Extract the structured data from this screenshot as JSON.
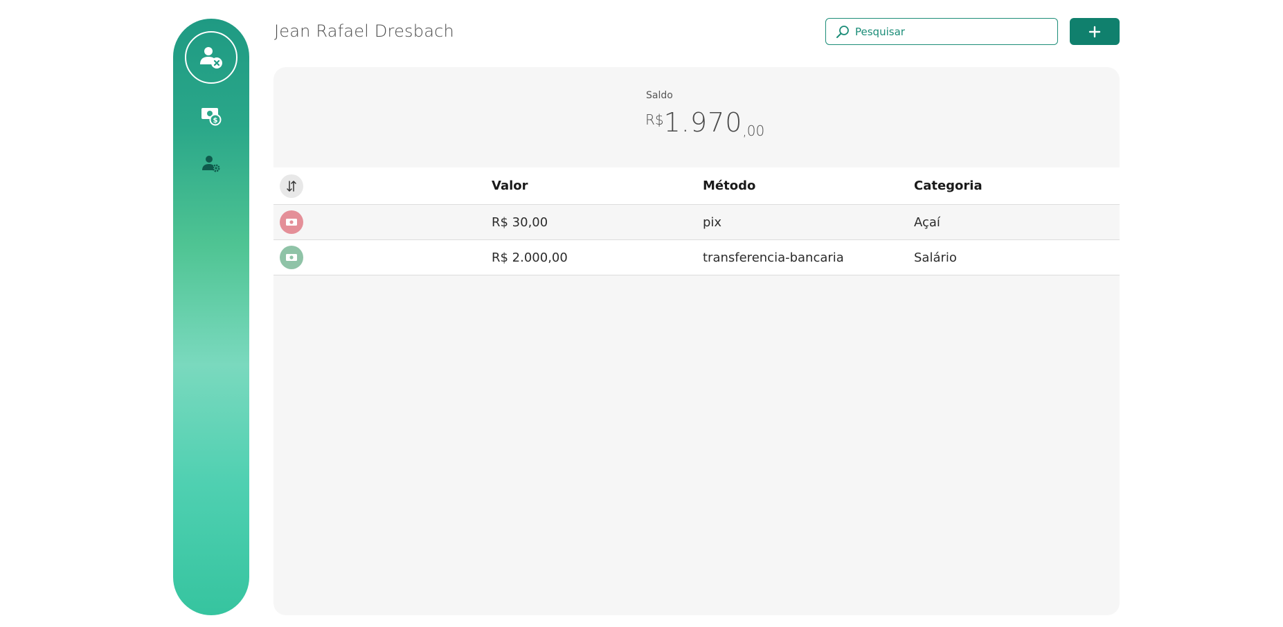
{
  "app": {
    "user_name": "Jean Rafael Dresbach"
  },
  "sidebar": {
    "items": [
      {
        "icon": "user-remove-icon",
        "label": ""
      },
      {
        "icon": "money-icon",
        "label": ""
      },
      {
        "icon": "user-settings-icon",
        "label": ""
      }
    ]
  },
  "search": {
    "placeholder": "Pesquisar",
    "value": ""
  },
  "toolbar": {
    "add_icon": "plus-icon"
  },
  "balance": {
    "label": "Saldo",
    "currency": "R$",
    "integer": "1.970",
    "cents": ",00"
  },
  "table": {
    "columns": [
      "Valor",
      "Método",
      "Categoria"
    ],
    "rows": [
      {
        "type": "saida",
        "valor": "R$ 30,00",
        "metodo": "pix",
        "categoria": "Açaí"
      },
      {
        "type": "entrada",
        "valor": "R$ 2.000,00",
        "metodo": "transferencia-bancaria",
        "categoria": "Salário"
      }
    ]
  },
  "colors": {
    "accent": "#10806d",
    "expense": "#e48f98",
    "income": "#8fc3a7"
  }
}
